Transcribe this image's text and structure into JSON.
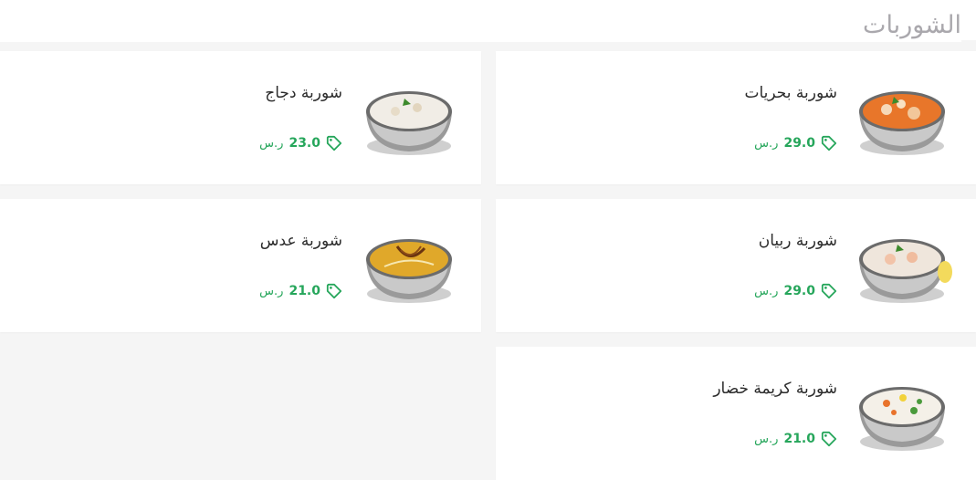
{
  "section": {
    "title": "الشوربات"
  },
  "items": [
    {
      "name": "شوربة بحريات",
      "price": "29.0",
      "currency": "ر.س"
    },
    {
      "name": "شوربة دجاج",
      "price": "23.0",
      "currency": "ر.س"
    },
    {
      "name": "شوربة ربيان",
      "price": "29.0",
      "currency": "ر.س"
    },
    {
      "name": "شوربة عدس",
      "price": "21.0",
      "currency": "ر.س"
    },
    {
      "name": "شوربة كريمة خضار",
      "price": "21.0",
      "currency": "ر.س"
    }
  ],
  "colors": {
    "price": "#26a65b",
    "title": "#aaa8ad",
    "name": "#2b2b2b"
  },
  "icons": {
    "price_tag": "price-tag-icon"
  }
}
